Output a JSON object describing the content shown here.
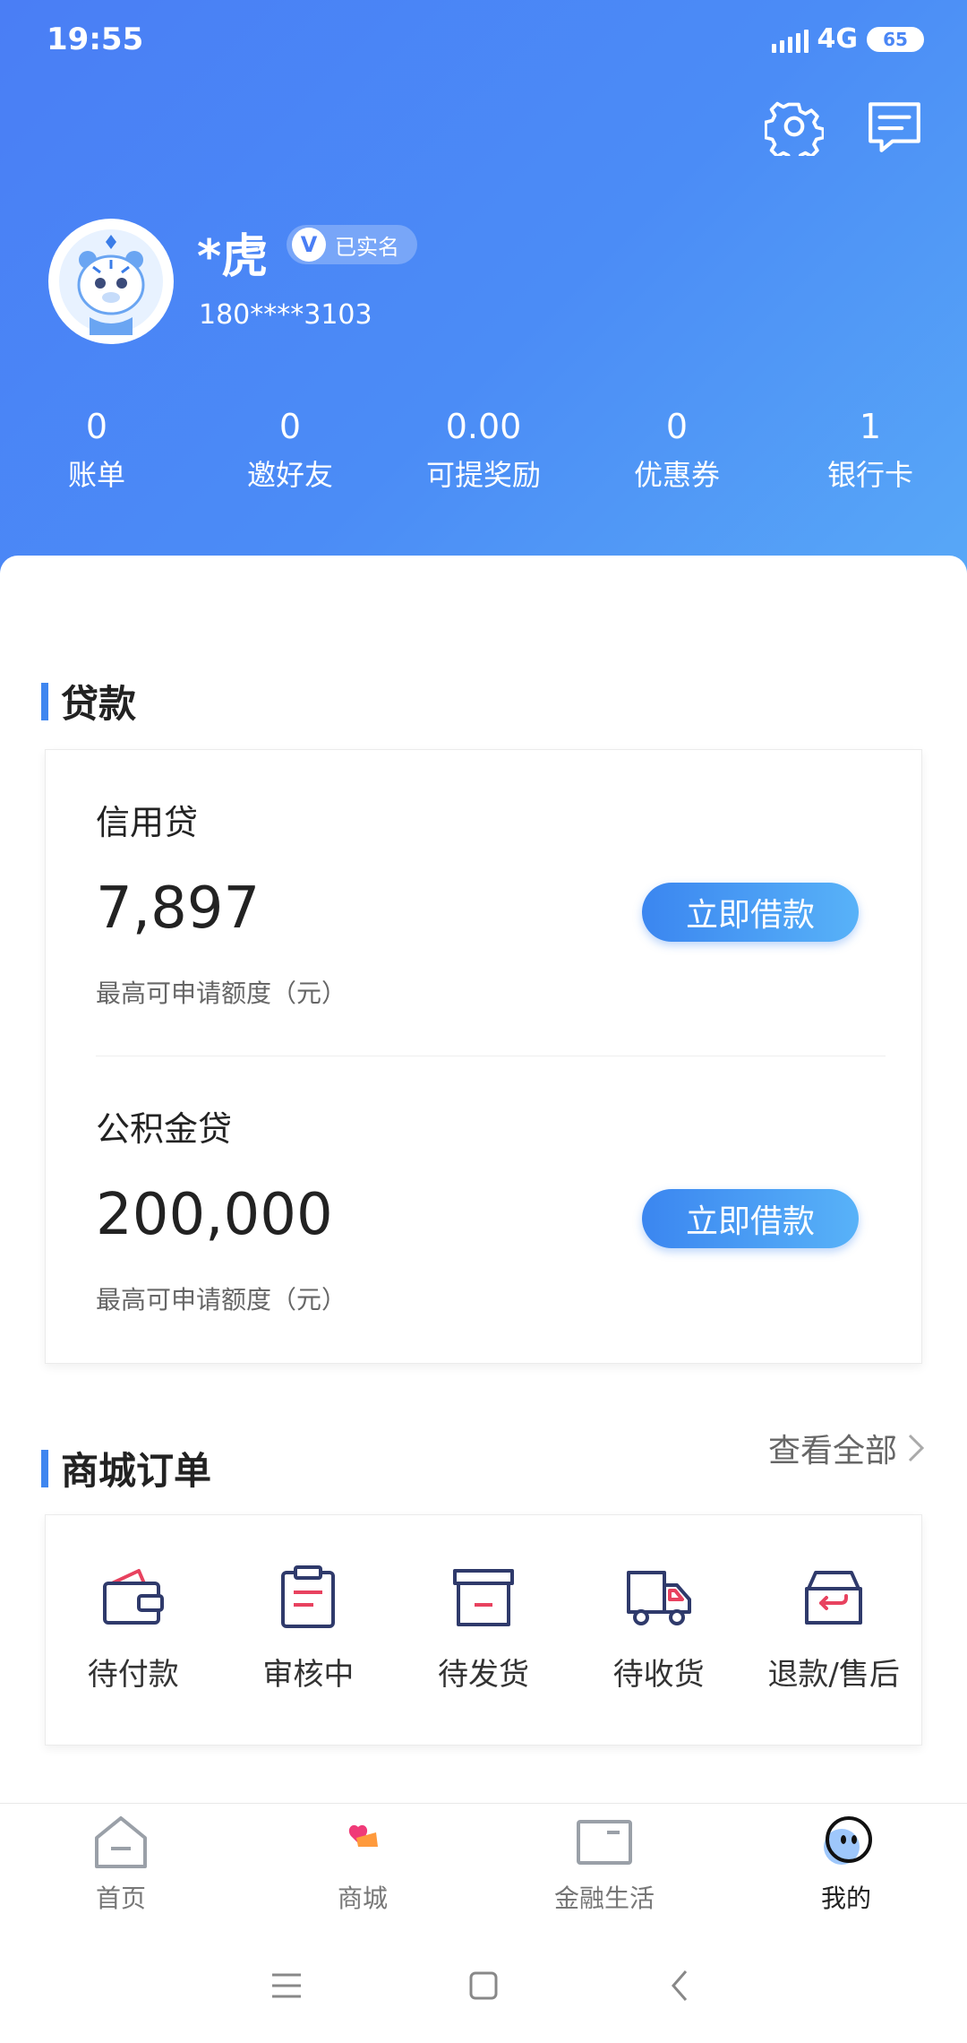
{
  "status_bar": {
    "time": "19:55",
    "network": "4G",
    "battery": "65"
  },
  "profile": {
    "name": "*虎",
    "verified_badge": "已实名",
    "verified_mark": "V",
    "phone": "180****3103"
  },
  "stats": [
    {
      "value": "0",
      "label": "账单"
    },
    {
      "value": "0",
      "label": "邀好友"
    },
    {
      "value": "0.00",
      "label": "可提奖励"
    },
    {
      "value": "0",
      "label": "优惠券"
    },
    {
      "value": "1",
      "label": "银行卡"
    }
  ],
  "loans": {
    "title": "贷款",
    "items": [
      {
        "name": "信用贷",
        "amount": "7,897",
        "desc": "最高可申请额度（元）",
        "button": "立即借款"
      },
      {
        "name": "公积金贷",
        "amount": "200,000",
        "desc": "最高可申请额度（元）",
        "button": "立即借款"
      }
    ]
  },
  "orders": {
    "title": "商城订单",
    "view_all": "查看全部",
    "items": [
      {
        "label": "待付款",
        "icon": "wallet-icon"
      },
      {
        "label": "审核中",
        "icon": "clipboard-icon"
      },
      {
        "label": "待发货",
        "icon": "box-icon"
      },
      {
        "label": "待收货",
        "icon": "truck-icon"
      },
      {
        "label": "退款/售后",
        "icon": "refund-icon"
      }
    ]
  },
  "bottom_nav": [
    {
      "label": "首页",
      "icon": "home-icon"
    },
    {
      "label": "商城",
      "icon": "mall-icon"
    },
    {
      "label": "金融生活",
      "icon": "finance-icon"
    },
    {
      "label": "我的",
      "icon": "mine-icon",
      "active": true
    }
  ],
  "colors": {
    "primary": "#4a7ef5",
    "accent_blue": "#3f86f0",
    "icon_navy": "#2f3a6b",
    "icon_red": "#e8425f"
  }
}
